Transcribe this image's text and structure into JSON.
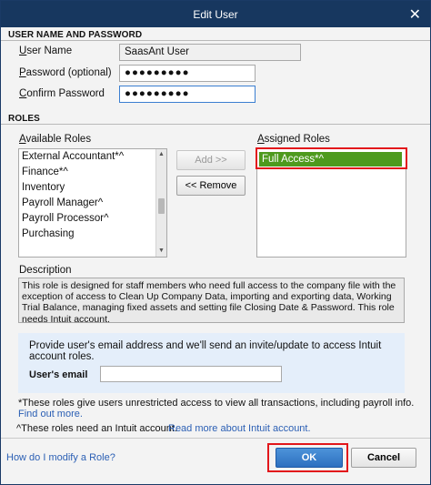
{
  "window": {
    "title": "Edit User",
    "close_glyph": "✕"
  },
  "credentials": {
    "heading": "USER NAME AND PASSWORD",
    "user_name_label": "ser Name",
    "user_name_mnemonic": "U",
    "user_name_value": "SaasAnt User",
    "password_label": "assword (optional)",
    "password_mnemonic": "P",
    "password_value": "●●●●●●●●●",
    "confirm_label": "onfirm Password",
    "confirm_mnemonic": "C",
    "confirm_value": "●●●●●●●●●"
  },
  "roles": {
    "heading": "ROLES",
    "available_label": "vailable Roles",
    "available_mnemonic": "A",
    "available": [
      "External Accountant*^",
      "Finance*^",
      "Inventory",
      "Payroll Manager^",
      "Payroll Processor^",
      "Purchasing"
    ],
    "add_label": "Add >>",
    "remove_label": "<< Remove",
    "assigned_label": "ssigned Roles",
    "assigned_mnemonic": "A",
    "assigned": [
      "Full Access*^"
    ]
  },
  "description": {
    "label": "Description",
    "text": "This role is designed for staff members who need full access to the company file with the exception of access to Clean Up Company Data, importing and exporting data, Working Trial Balance, managing fixed assets and setting file Closing Date & Password. This role needs Intuit account."
  },
  "invite": {
    "text": "Provide user's email address and we'll send an invite/update to access Intuit account roles.",
    "email_label": "User's email",
    "email_value": ""
  },
  "notes": {
    "unrestricted": "*These roles give users unrestricted access to view all transactions, including payroll info.",
    "find_out_more": "Find out more.",
    "intuit_account": "^These roles need an Intuit account.",
    "read_more": "Read more about Intuit account."
  },
  "footer": {
    "help_link": "How do I modify a Role?",
    "ok_label": "OK",
    "cancel_label": "Cancel"
  },
  "colors": {
    "titlebar": "#17375f",
    "selected_role": "#4e9a1d",
    "highlight": "#e2161b",
    "ok": "#2d70c0",
    "link": "#2b5fb4"
  }
}
